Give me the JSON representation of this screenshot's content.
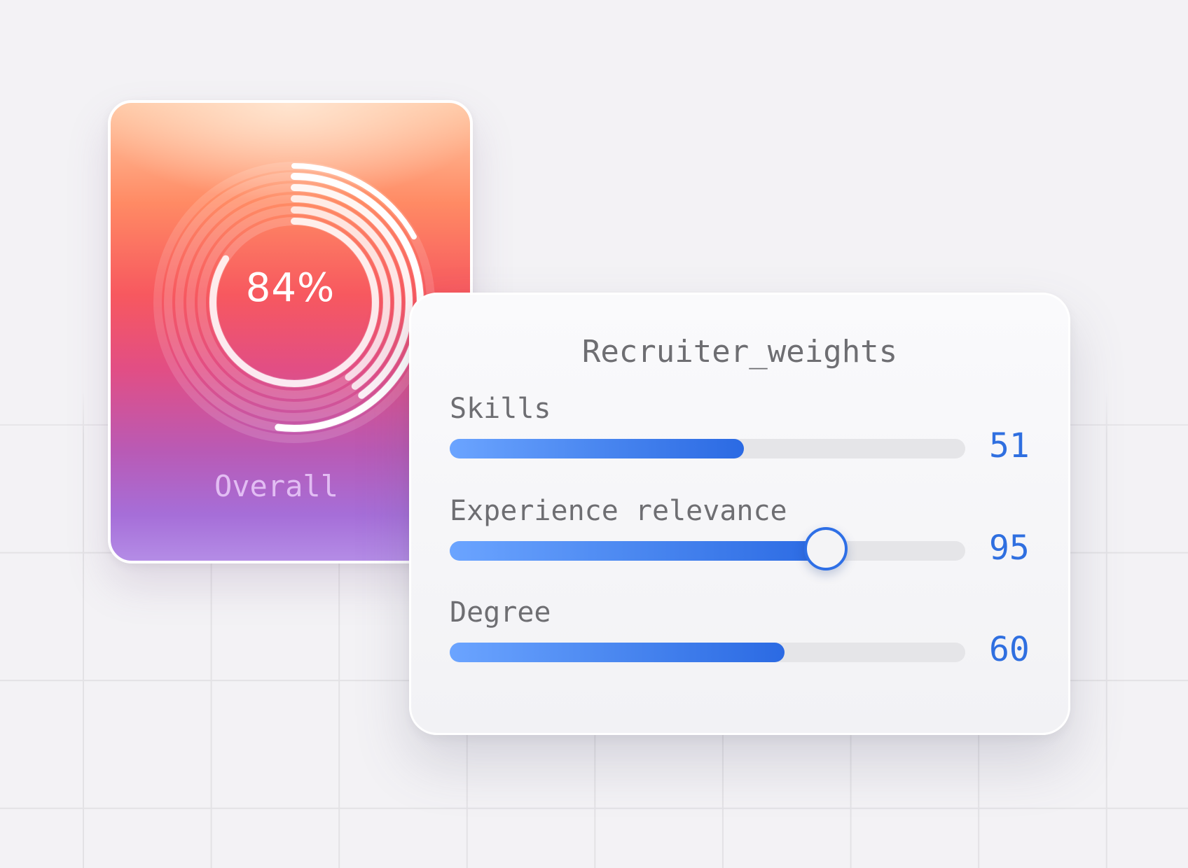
{
  "score_card": {
    "value": "84%",
    "label": "Overall",
    "progress": 0.84
  },
  "weights_panel": {
    "title": "Recruiter_weights",
    "sliders": [
      {
        "label": "Skills",
        "value": "51",
        "fill": 0.57,
        "thumb": false
      },
      {
        "label": "Experience relevance",
        "value": "95",
        "fill": 0.73,
        "thumb": true
      },
      {
        "label": "Degree",
        "value": "60",
        "fill": 0.65,
        "thumb": false
      }
    ]
  },
  "colors": {
    "accent": "#2f6fe0",
    "track": "#e5e5e8",
    "label_text": "#6e6e72"
  }
}
